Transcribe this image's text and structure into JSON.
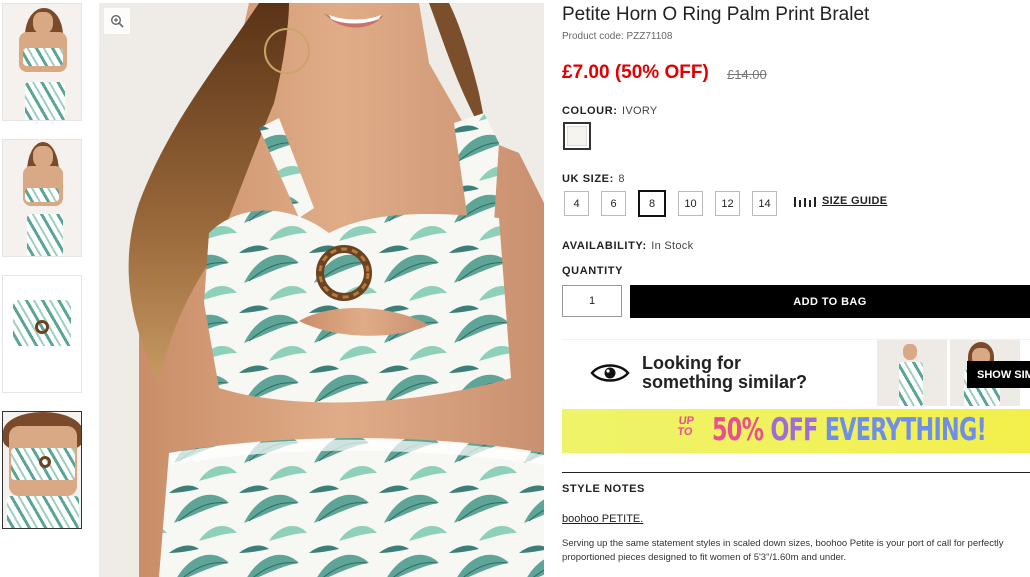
{
  "product": {
    "title": "Petite Horn O Ring Palm Print Bralet",
    "product_code": "Product code: PZZ71108",
    "price": "£7.00 (50% OFF)",
    "old_price": "£14.00"
  },
  "colour": {
    "label": "COLOUR:",
    "value": "IVORY",
    "swatch_color": "#f6f4ee"
  },
  "size": {
    "label": "UK SIZE:",
    "value": "8",
    "options": [
      "4",
      "6",
      "8",
      "10",
      "12",
      "14"
    ],
    "selected": "8",
    "guide_label": "SIZE GUIDE"
  },
  "availability": {
    "label": "AVAILABILITY:",
    "value": "In Stock"
  },
  "quantity": {
    "label": "QUANTITY",
    "value": "1"
  },
  "add_to_bag_label": "ADD TO BAG",
  "similar": {
    "line1": "Looking for",
    "line2": "something similar?",
    "button_label": "SHOW SIM"
  },
  "promo": {
    "upto_line1": "UP",
    "upto_line2": "TO",
    "pct": "50%",
    "off": "OFF",
    "everything": "EVERYTHING!"
  },
  "style_notes": {
    "heading": "STYLE NOTES",
    "link": "boohoo PETITE.",
    "text": "Serving up the same statement styles in scaled down sizes, boohoo Petite is your port of call for perfectly proportioned pieces designed to fit women of 5'3\"/1.60m and under."
  },
  "icons": {
    "zoom": "magnifier-plus-icon",
    "size_guide": "ruler-bars-icon",
    "similar": "eye-icon"
  },
  "colors": {
    "price_red": "#e10000",
    "button_black": "#000000",
    "promo_yellow": "#eef36a",
    "promo_pink": "#e8508f"
  }
}
